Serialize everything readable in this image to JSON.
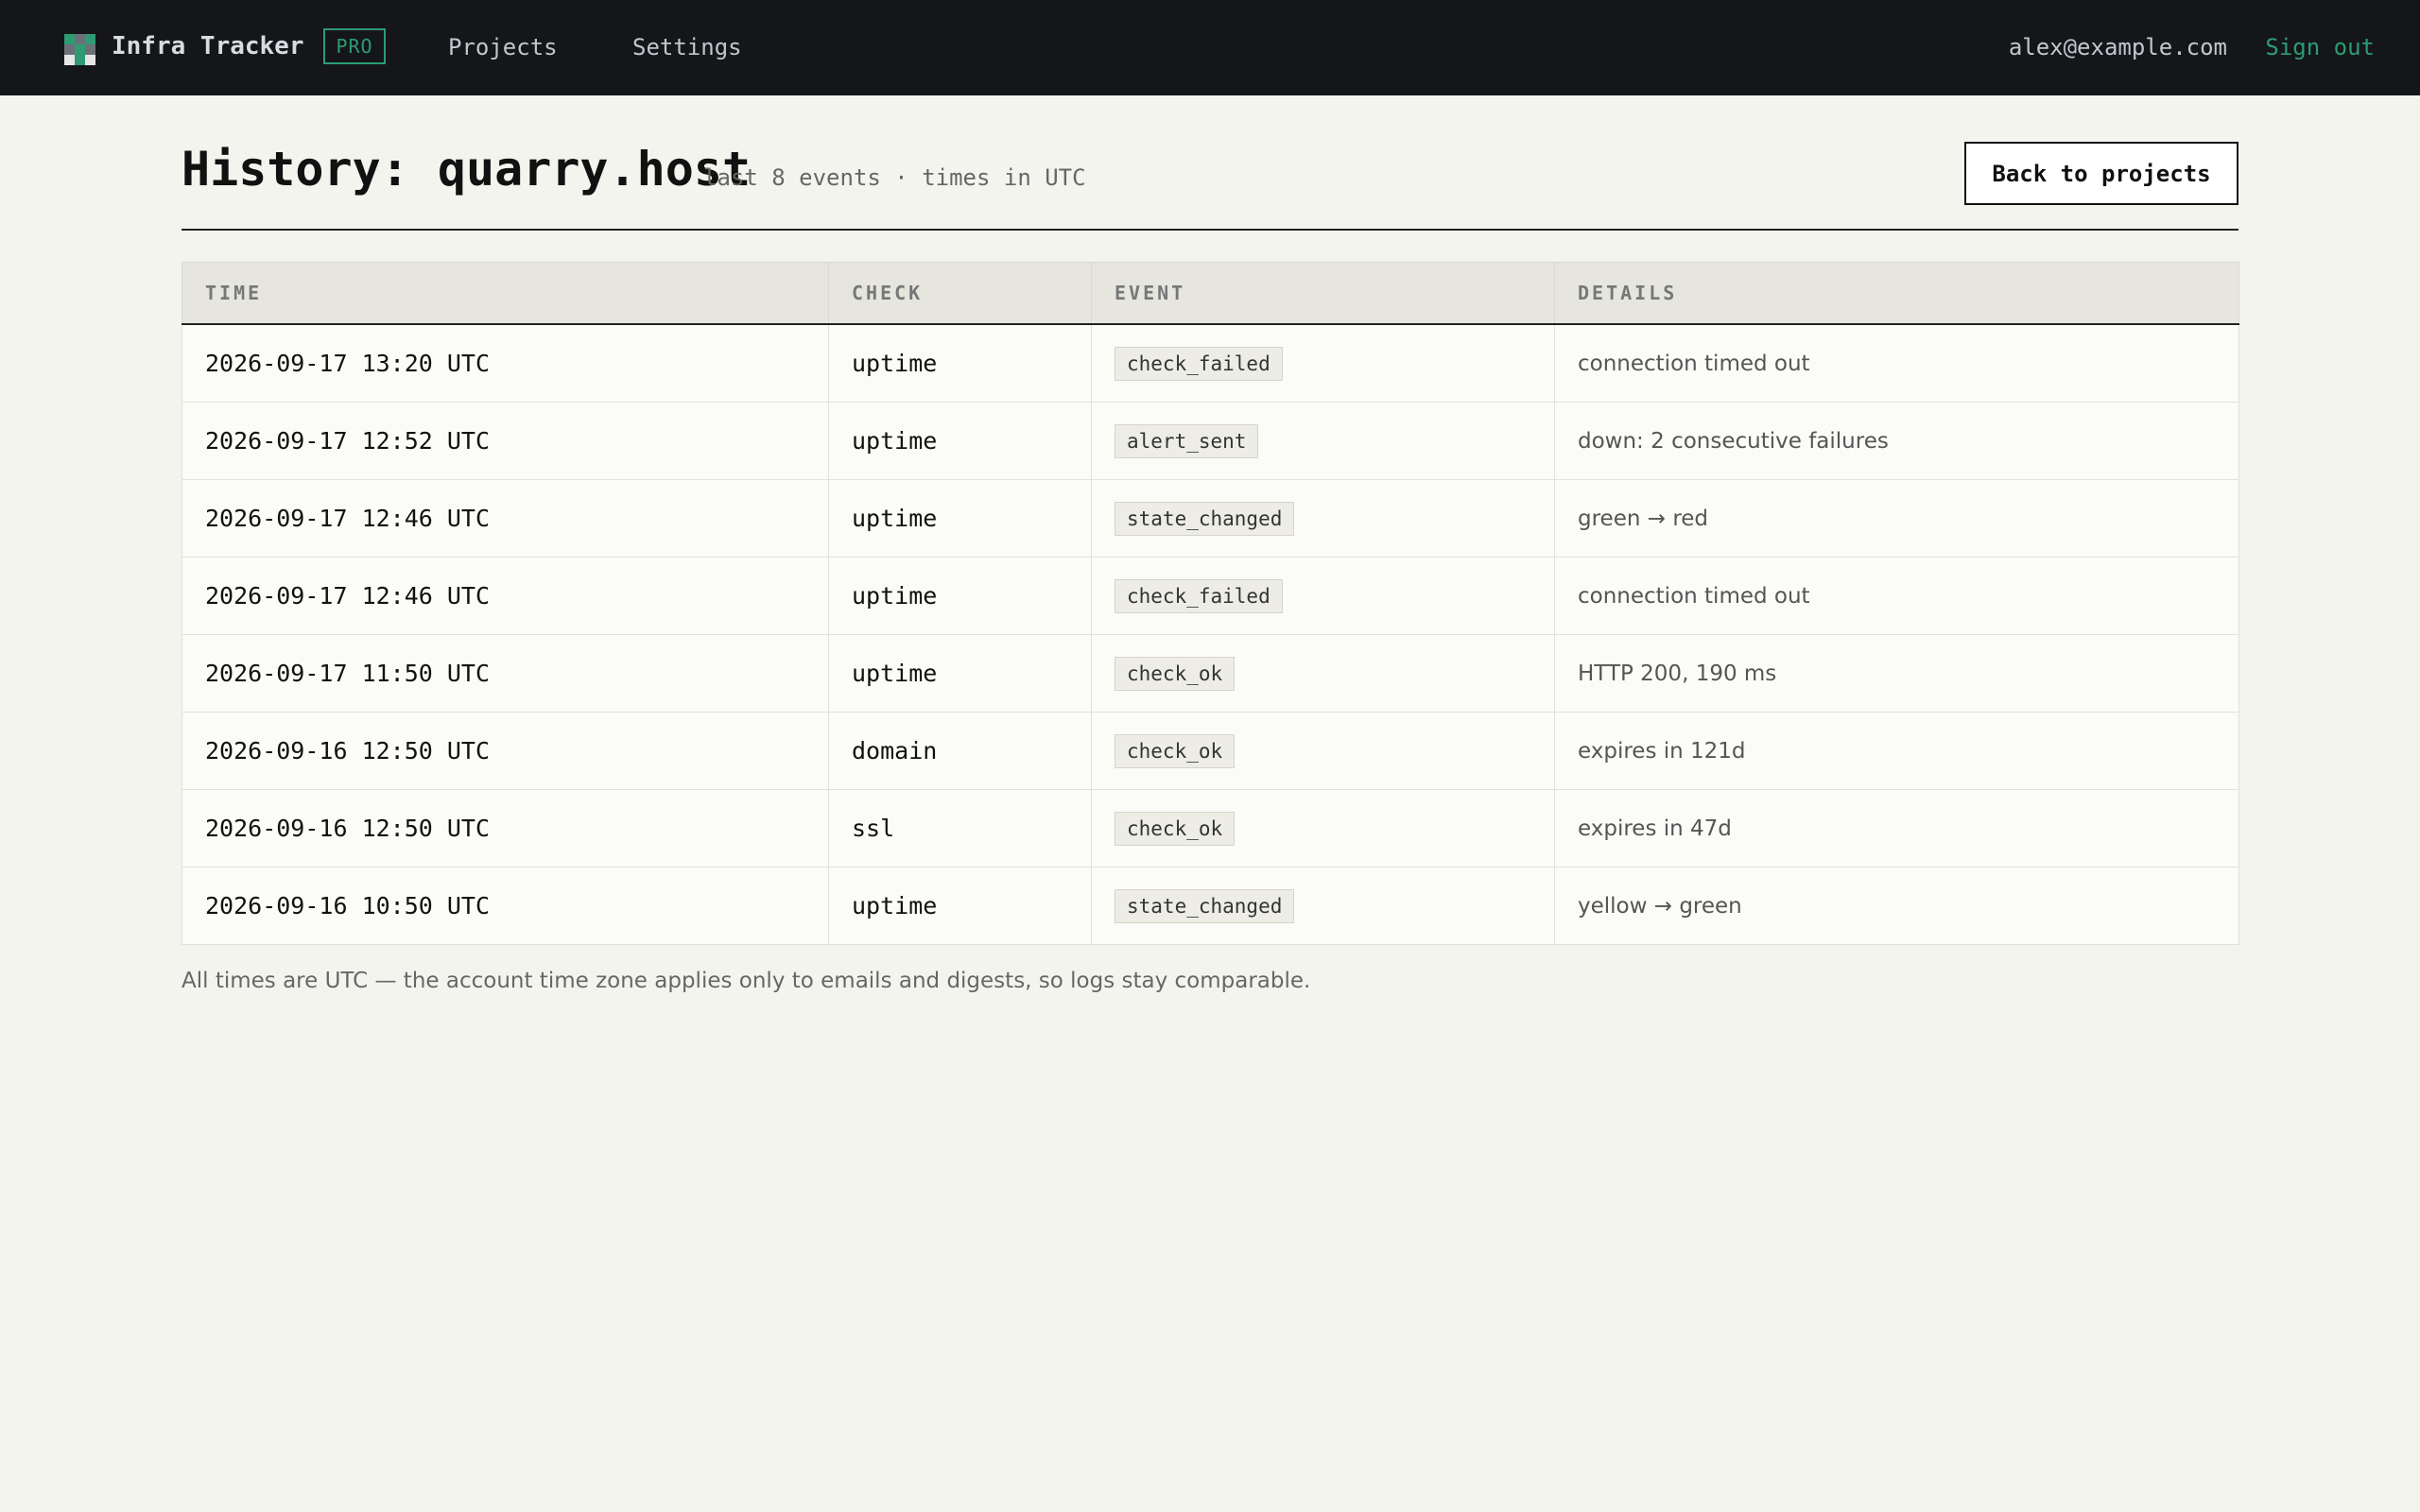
{
  "nav": {
    "brand": "Infra Tracker",
    "plan_badge": "PRO",
    "links": [
      "Projects",
      "Settings"
    ],
    "user_email": "alex@example.com",
    "sign_out": "Sign out"
  },
  "header": {
    "title": "History: quarry.host",
    "subtitle": "last 8 events · times in UTC",
    "back_button": "Back to projects"
  },
  "table": {
    "columns": [
      "TIME",
      "CHECK",
      "EVENT",
      "DETAILS"
    ],
    "rows": [
      {
        "time": "2026-09-17 13:20 UTC",
        "check": "uptime",
        "event": "check_failed",
        "details": "connection timed out"
      },
      {
        "time": "2026-09-17 12:52 UTC",
        "check": "uptime",
        "event": "alert_sent",
        "details": "down: 2 consecutive failures"
      },
      {
        "time": "2026-09-17 12:46 UTC",
        "check": "uptime",
        "event": "state_changed",
        "details": "green → red"
      },
      {
        "time": "2026-09-17 12:46 UTC",
        "check": "uptime",
        "event": "check_failed",
        "details": "connection timed out"
      },
      {
        "time": "2026-09-17 11:50 UTC",
        "check": "uptime",
        "event": "check_ok",
        "details": "HTTP 200, 190 ms"
      },
      {
        "time": "2026-09-16 12:50 UTC",
        "check": "domain",
        "event": "check_ok",
        "details": "expires in 121d"
      },
      {
        "time": "2026-09-16 12:50 UTC",
        "check": "ssl",
        "event": "check_ok",
        "details": "expires in 47d"
      },
      {
        "time": "2026-09-16 10:50 UTC",
        "check": "uptime",
        "event": "state_changed",
        "details": "yellow → green"
      }
    ]
  },
  "footnote": "All times are UTC — the account time zone applies only to emails and digests, so logs stay comparable.",
  "colors": {
    "topbar": "#14161a",
    "accent": "#2e9b72",
    "background": "#f4f4ef"
  }
}
